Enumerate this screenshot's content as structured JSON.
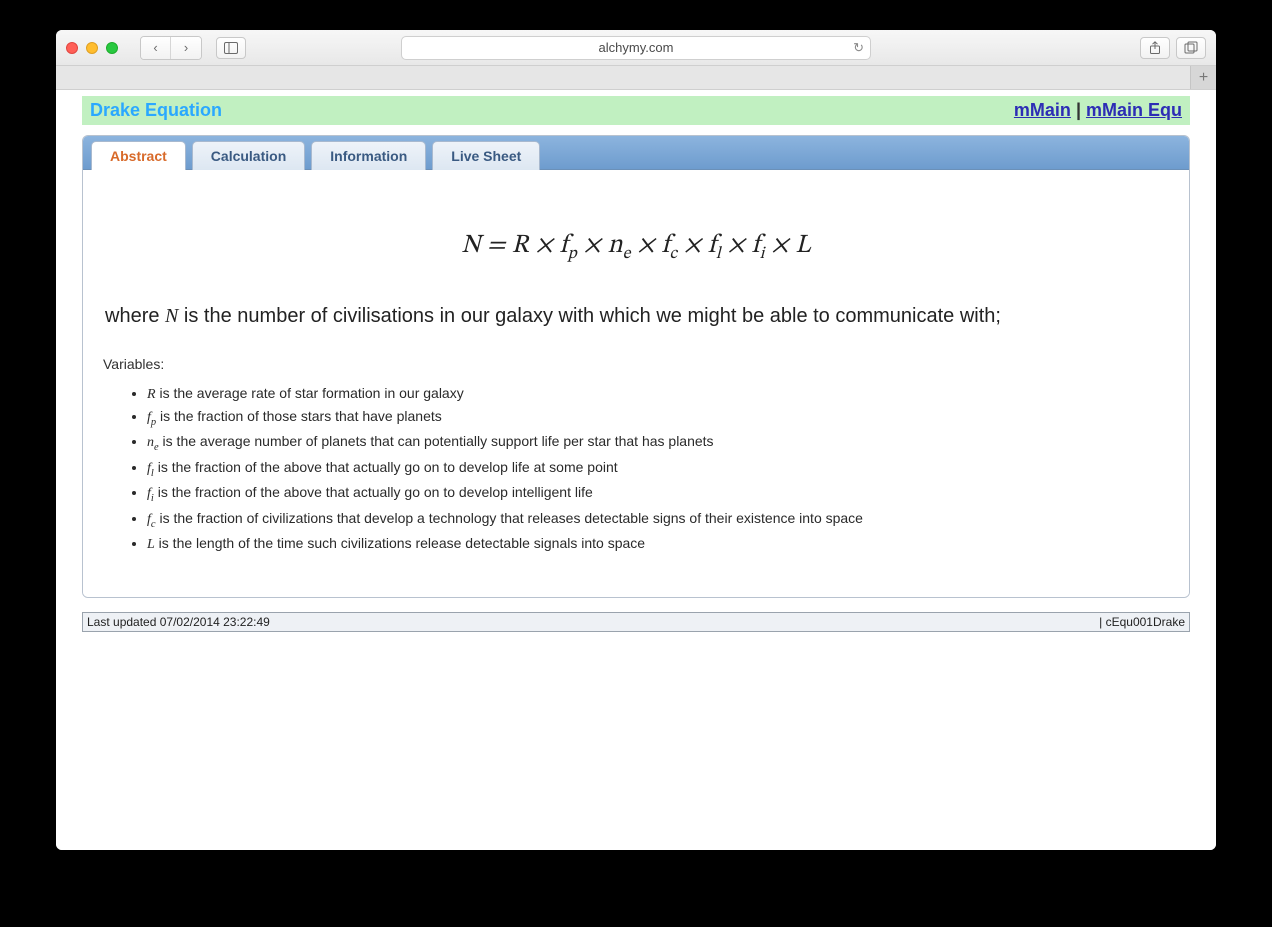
{
  "browser": {
    "url": "alchymy.com"
  },
  "header": {
    "title": "Drake Equation",
    "link1": "mMain",
    "sep": " | ",
    "link2": "mMain Equ"
  },
  "tabs": [
    {
      "label": "Abstract",
      "active": true
    },
    {
      "label": "Calculation",
      "active": false
    },
    {
      "label": "Information",
      "active": false
    },
    {
      "label": "Live Sheet",
      "active": false
    }
  ],
  "content": {
    "equation_html": "N = R × f<sub>p</sub> × n<sub>e</sub> × f<sub>c</sub> × f<sub>l</sub> × f<sub>i</sub> × L",
    "where_prefix": "where ",
    "where_symbol": "N",
    "where_rest": " is the number of civilisations in our galaxy with which we might be able to communicate with;",
    "variables_label": "Variables:",
    "variables": [
      {
        "sym": "R",
        "desc": " is the average rate of star formation in our galaxy"
      },
      {
        "sym": "f<sub>p</sub>",
        "desc": " is the fraction of those stars that have planets"
      },
      {
        "sym": "n<sub>e</sub>",
        "desc": " is the average number of planets that can potentially support life per star that has planets"
      },
      {
        "sym": "f<sub>l</sub>",
        "desc": " is the fraction of the above that actually go on to develop life at some point"
      },
      {
        "sym": "f<sub>i</sub>",
        "desc": " is the fraction of the above that actually go on to develop intelligent life"
      },
      {
        "sym": "f<sub>c</sub>",
        "desc": " is the fraction of civilizations that develop a technology that releases detectable signs of their existence into space"
      },
      {
        "sym": "L",
        "desc": " is the length of the time such civilizations release detectable signals into space"
      }
    ]
  },
  "footer": {
    "left": "Last updated 07/02/2014 23:22:49",
    "right": "| cEqu001Drake"
  }
}
